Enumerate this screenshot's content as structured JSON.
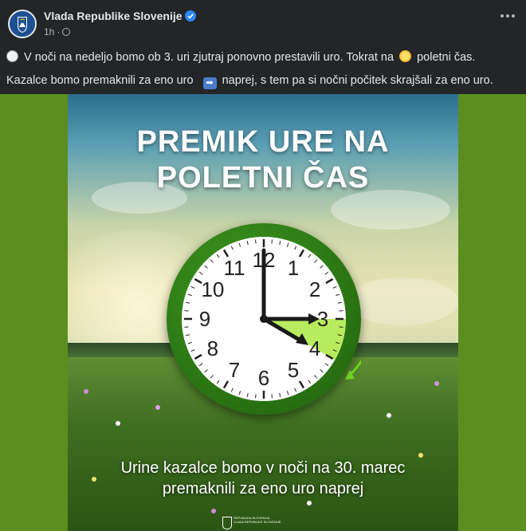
{
  "post": {
    "author": "Vlada Republike Slovenije",
    "time": "1h",
    "line1_a": "V noči na nedeljo bomo ob 3. uri zjutraj ponovno prestavili uro. Tokrat na",
    "line1_b": "poletni čas.",
    "line2_a": "Kazalce bomo premaknili za eno uro",
    "line2_b": "naprej, s tem pa si nočni počitek skrajšali za eno uro.",
    "icons": [
      "clock-emoji",
      "sun-emoji",
      "right-arrow-emoji",
      "globe-icon",
      "verified-icon",
      "more-icon"
    ]
  },
  "image": {
    "title_line1": "PREMIK URE NA",
    "title_line2": "POLETNI ČAS",
    "caption_line1": "Urine kazalce bomo v noči na 30. marec",
    "caption_line2": "premaknili za eno uro naprej",
    "logo_line1": "REPUBLIKA SLOVENIJA",
    "logo_line2": "VLADA REPUBLIKE SLOVENIJE",
    "clock_numbers": [
      "12",
      "1",
      "2",
      "3",
      "4",
      "5",
      "6",
      "7",
      "8",
      "9",
      "10",
      "11"
    ],
    "colors": {
      "accent": "#7ed321",
      "frame": "#2e7d16",
      "background": "#5c8e1f"
    }
  }
}
